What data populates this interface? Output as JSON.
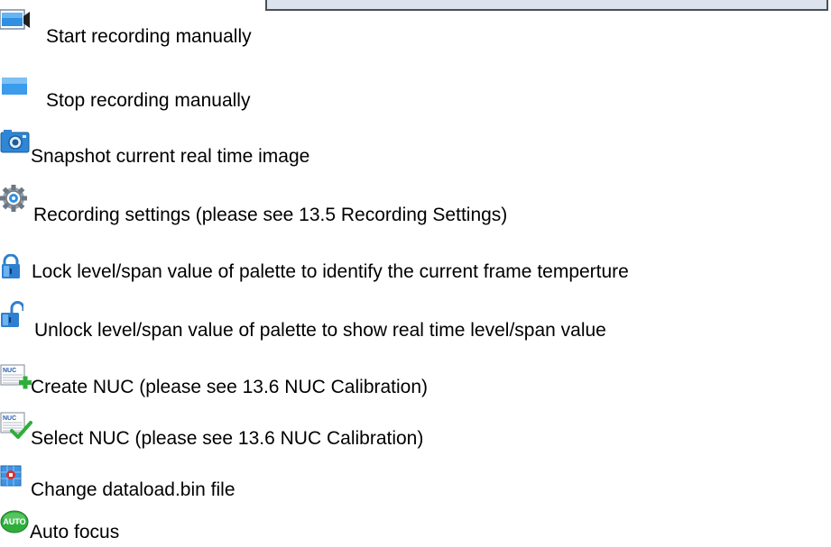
{
  "items": [
    {
      "label": "Start recording manually",
      "icon": "video-camera-icon"
    },
    {
      "label": "Stop recording manually",
      "icon": "stop-icon"
    },
    {
      "label": "Snapshot current real time image",
      "icon": "camera-icon"
    },
    {
      "label": "Recording settings (please see 13.5 Recording Settings)",
      "icon": "gear-icon"
    },
    {
      "label": "Lock level/span value of palette to identify the current frame temperture",
      "icon": "lock-icon"
    },
    {
      "label": "Unlock level/span value of palette to show real time level/span value",
      "icon": "unlock-icon"
    },
    {
      "label": "Create NUC (please see 13.6 NUC Calibration)",
      "icon": "nuc-create-icon"
    },
    {
      "label": "Select NUC (please see 13.6 NUC Calibration)",
      "icon": "nuc-select-icon"
    },
    {
      "label": "Change dataload.bin file",
      "icon": "dataload-icon"
    },
    {
      "label": "Auto focus",
      "icon": "autofocus-icon"
    }
  ],
  "icon_text": {
    "nuc": "NUC",
    "auto": "AUTO"
  },
  "colors": {
    "frame_border": "#4a4f58",
    "frame_fill": "#dde3ec",
    "icon_blue": "#2f8fe0",
    "icon_green": "#2eae3a",
    "icon_red": "#d8322c"
  }
}
